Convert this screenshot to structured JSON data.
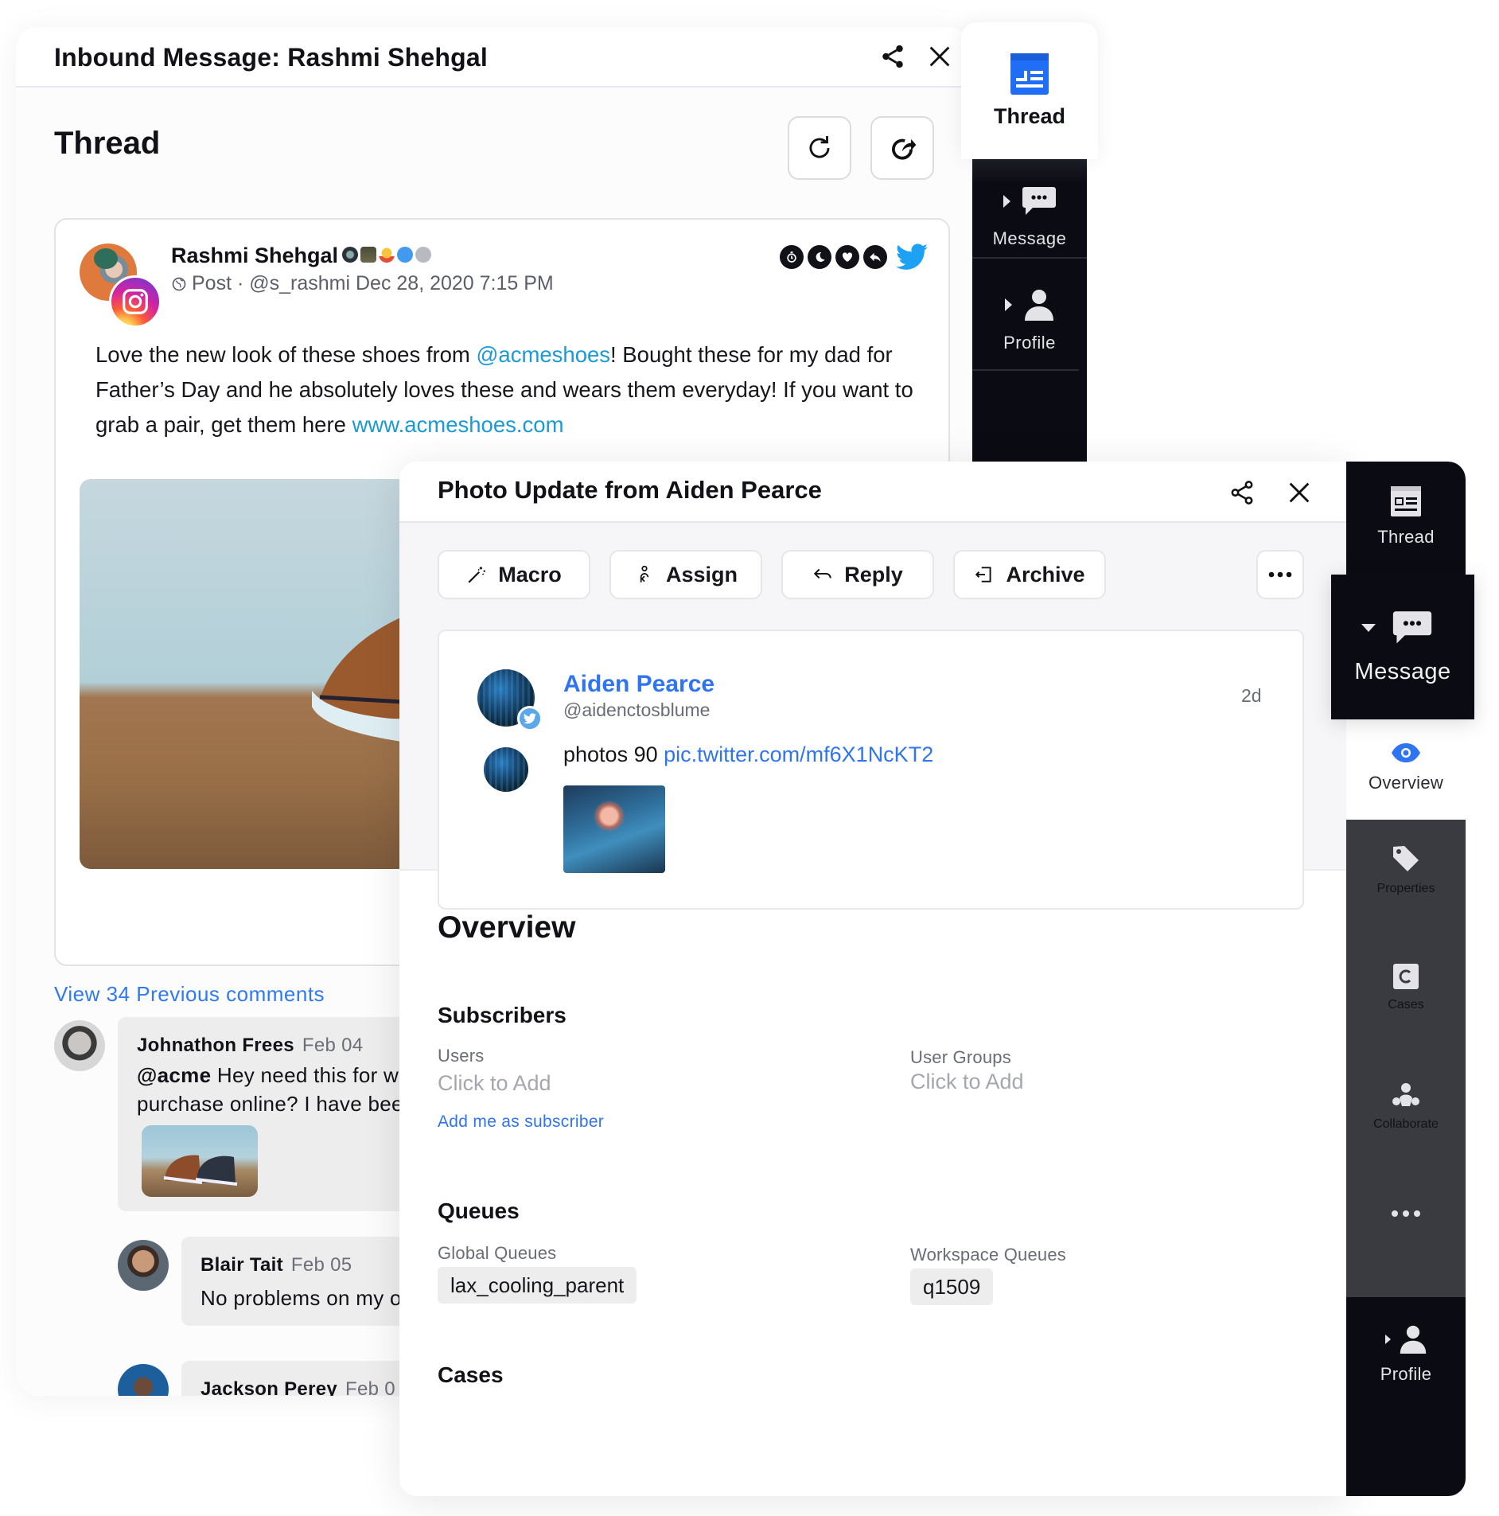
{
  "back_panel": {
    "title": "Inbound Message: Rashmi Shehgal",
    "section_title": "Thread",
    "icons": [
      "share-icon",
      "close-icon",
      "refresh-icon",
      "forward-icon"
    ],
    "post": {
      "author": "Rashmi Shehgal",
      "network": "instagram",
      "meta": "Post · @s_rashmi Dec 28, 2020 7:15 PM",
      "badges": [
        "photo-badge",
        "photo-badge",
        "award-badge",
        "document-badge",
        "sad-face-badge"
      ],
      "actions": [
        "stopwatch-icon",
        "moon-icon",
        "heart-icon",
        "reply-icon",
        "twitter-icon"
      ],
      "body_parts": {
        "p1": "Love the new look of these shoes from ",
        "mention": "@acmeshoes",
        "p2": "! Bought these for my dad for Father’s Day and he absolutely loves these and wears them everyday! If you want to grab a pair, get them here ",
        "link": "www.acmeshoes.com"
      }
    },
    "view_previous": "View 34 Previous comments",
    "comments": [
      {
        "name": "Johnathon Frees",
        "date": "Feb 04",
        "mention": "@acme",
        "line1": " Hey need this for w",
        "line2": "purchase online? I have bee"
      },
      {
        "name": "Blair Tait",
        "date": "Feb 05",
        "line1": "No problems on my o"
      },
      {
        "name": "Jackson Perey",
        "date": "Feb 0"
      }
    ]
  },
  "back_tabs": {
    "thread": "Thread",
    "message": "Message",
    "profile": "Profile",
    "accent": "#1f6ef5"
  },
  "front_panel": {
    "title": "Photo Update from Aiden Pearce",
    "actions": {
      "macro": "Macro",
      "assign": "Assign",
      "reply": "Reply",
      "archive": "Archive"
    },
    "message": {
      "name": "Aiden Pearce",
      "handle": "@aidenctosblume",
      "time": "2d",
      "text": "photos 90 ",
      "link": "pic.twitter.com/mf6X1NcKT2"
    },
    "overview": {
      "title": "Overview",
      "subscribers": {
        "title": "Subscribers",
        "users_label": "Users",
        "users_value": "Click to Add",
        "groups_label": "User Groups",
        "groups_value": "Click to Add",
        "add_me": "Add me as subscriber"
      },
      "queues": {
        "title": "Queues",
        "global_label": "Global Queues",
        "global_value": "lax_cooling_parent",
        "workspace_label": "Workspace Queues",
        "workspace_value": "q1509"
      },
      "cases_title": "Cases"
    }
  },
  "front_nav": {
    "thread": "Thread",
    "message": "Message",
    "overview": "Overview",
    "properties": "Properties",
    "cases": "Cases",
    "collaborate": "Collaborate",
    "profile": "Profile",
    "accent": "#2f74f0"
  }
}
